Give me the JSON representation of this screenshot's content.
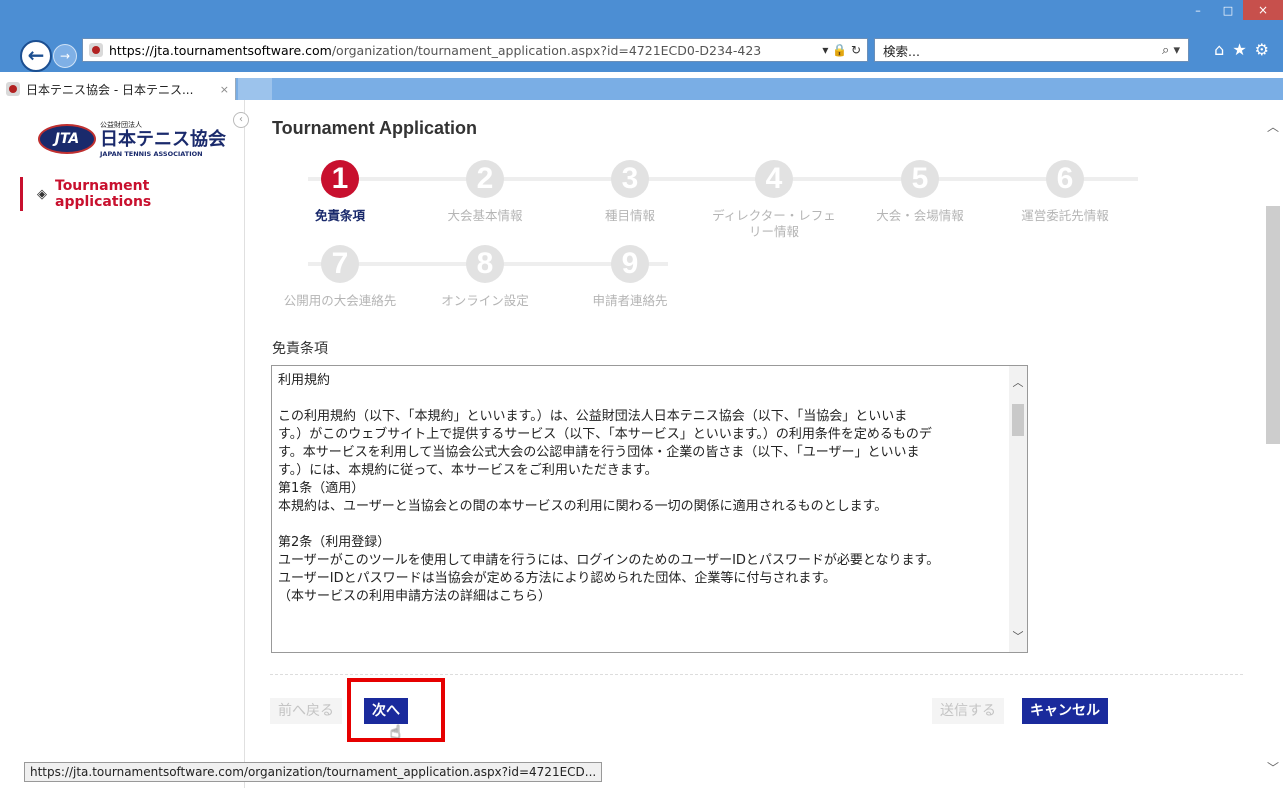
{
  "browser": {
    "url_scheme": "https://",
    "url_host": "jta.tournamentsoftware.com",
    "url_path": "/organization/tournament_application.aspx?id=4721ECD0-D234-423",
    "address_actions": "▾ 🔒 ↻",
    "search_placeholder": "検索...",
    "search_icon": "⌕ ▾",
    "tab_title": "日本テニス協会 - 日本テニス...",
    "tab_close": "×",
    "window_buttons": {
      "minimize": "–",
      "maximize": "□",
      "close": "×"
    },
    "toolbar_icons": {
      "home": "⌂",
      "favorites": "★",
      "settings": "⚙"
    }
  },
  "sidebar": {
    "logo_small": "公益財団法人",
    "logo_main": "日本テニス協会",
    "logo_english": "JAPAN TENNIS ASSOCIATION",
    "logo_emblem": "JTA",
    "collapse": "‹",
    "items": [
      {
        "label": "Tournament applications",
        "icon": "shield-icon"
      }
    ]
  },
  "main": {
    "title": "Tournament Application",
    "steps": [
      {
        "number": "1",
        "label": "免責条項",
        "active": true
      },
      {
        "number": "2",
        "label": "大会基本情報"
      },
      {
        "number": "3",
        "label": "種目情報"
      },
      {
        "number": "4",
        "label": "ディレクター・レフェリー情報"
      },
      {
        "number": "5",
        "label": "大会・会場情報"
      },
      {
        "number": "6",
        "label": "運営委託先情報"
      },
      {
        "number": "7",
        "label": "公開用の大会連絡先"
      },
      {
        "number": "8",
        "label": "オンライン設定"
      },
      {
        "number": "9",
        "label": "申請者連絡先"
      }
    ],
    "section_label": "免責条項",
    "terms": {
      "heading": "利用規約",
      "para1_l1": "この利用規約（以下、「本規約」といいます。）は、公益財団法人日本テニス協会（以下、「当協会」といいま",
      "para1_l2": "す。）がこのウェブサイト上で提供するサービス（以下、「本サービス」といいます。）の利用条件を定めるものデ",
      "para1_l3": "す。本サービスを利用して当協会公式大会の公認申請を行う団体・企業の皆さま（以下、「ユーザー」といいま",
      "para1_l4": "す。）には、本規約に従って、本サービスをご利用いただきます。",
      "art1_title": "第1条（適用）",
      "art1_body": "本規約は、ユーザーと当協会との間の本サービスの利用に関わる一切の関係に適用されるものとします。",
      "art2_title": "第2条（利用登録）",
      "art2_l1": "ユーザーがこのツールを使用して申請を行うには、ログインのためのユーザーIDとパスワードが必要となります。",
      "art2_l2": "ユーザーIDとパスワードは当協会が定める方法により認められた団体、企業等に付与されます。",
      "art2_l3": "（本サービスの利用申請方法の詳細はこちら）"
    },
    "buttons": {
      "prev": "前へ戻る",
      "next": "次へ",
      "send": "送信する",
      "cancel": "キャンセル"
    }
  },
  "status_url": "https://jta.tournamentsoftware.com/organization/tournament_application.aspx?id=4721ECD...",
  "colors": {
    "accent_red": "#c8102e",
    "brand_navy": "#1a2a9c",
    "chrome_blue": "#4c8ed3"
  }
}
